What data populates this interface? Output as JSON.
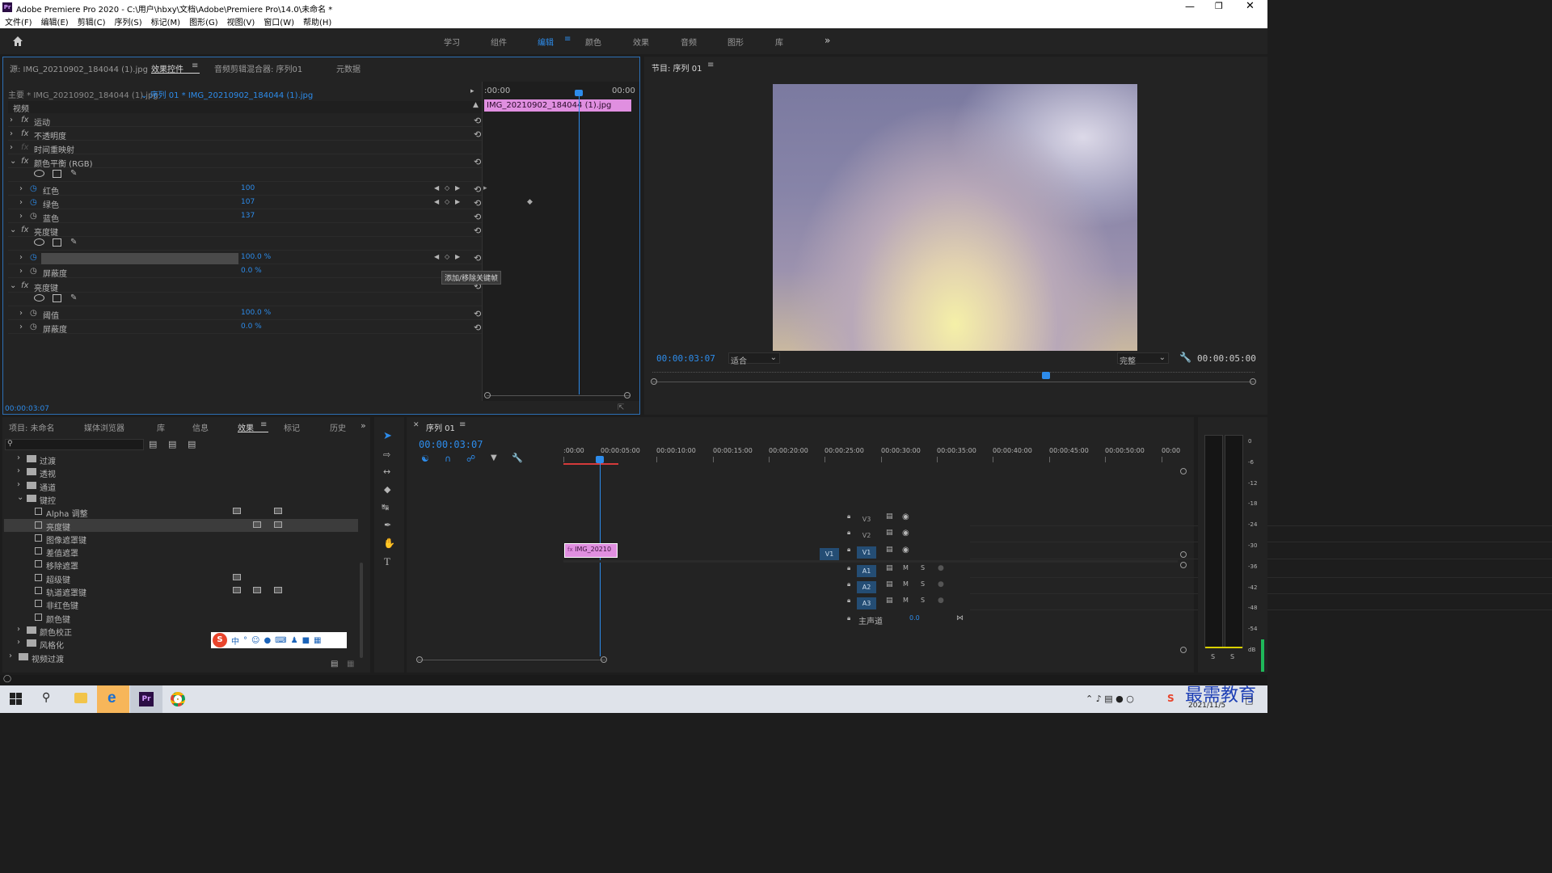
{
  "window": {
    "title": "Adobe Premiere Pro 2020 - C:\\用户\\hbxy\\文档\\Adobe\\Premiere Pro\\14.0\\未命名 *",
    "app_icon": "Pr"
  },
  "menu": [
    "文件(F)",
    "编辑(E)",
    "剪辑(C)",
    "序列(S)",
    "标记(M)",
    "图形(G)",
    "视图(V)",
    "窗口(W)",
    "帮助(H)"
  ],
  "workspaces": [
    {
      "label": "学习",
      "active": false
    },
    {
      "label": "组件",
      "active": false
    },
    {
      "label": "编辑",
      "active": true
    },
    {
      "label": "颜色",
      "active": false
    },
    {
      "label": "效果",
      "active": false
    },
    {
      "label": "音频",
      "active": false
    },
    {
      "label": "图形",
      "active": false
    },
    {
      "label": "库",
      "active": false
    }
  ],
  "effect_panel": {
    "tabs": [
      {
        "label": "源: IMG_20210902_184044 (1).jpg",
        "active": false
      },
      {
        "label": "效果控件",
        "active": true
      },
      {
        "label": "音频剪辑混合器: 序列01",
        "active": false
      },
      {
        "label": "元数据",
        "active": false
      }
    ],
    "master_label": "主要 * IMG_20210902_184044 (1).jpg",
    "sequence_label": "序列 01 * IMG_20210902_184044 (1).jpg",
    "section": "视频",
    "tl_start": ":00:00",
    "tl_end": "00:00",
    "clip_name": "IMG_20210902_184044 (1).jpg",
    "timecode": "00:00:03:07",
    "tooltip": "添加/移除关键帧",
    "rows": [
      {
        "type": "fx",
        "name": "运动"
      },
      {
        "type": "fx",
        "name": "不透明度"
      },
      {
        "type": "fx",
        "name": "时间重映射"
      },
      {
        "type": "fx",
        "name": "颜色平衡 (RGB)"
      },
      {
        "type": "prop",
        "name": "红色",
        "value": "100"
      },
      {
        "type": "prop",
        "name": "绿色",
        "value": "107"
      },
      {
        "type": "prop",
        "name": "蓝色",
        "value": "137"
      },
      {
        "type": "fx",
        "name": "亮度键"
      },
      {
        "type": "prop",
        "name": "阈值",
        "value": "100.0 %"
      },
      {
        "type": "prop",
        "name": "屏蔽度",
        "value": "0.0 %"
      },
      {
        "type": "fx",
        "name": "亮度键"
      },
      {
        "type": "prop",
        "name": "阈值",
        "value": "100.0 %"
      },
      {
        "type": "prop",
        "name": "屏蔽度",
        "value": "0.0 %"
      }
    ]
  },
  "program": {
    "title": "节目: 序列 01",
    "timecode": "00:00:03:07",
    "fit": "适合",
    "quality": "完整",
    "duration": "00:00:05:00"
  },
  "project": {
    "tabs": [
      {
        "label": "项目: 未命名",
        "active": false
      },
      {
        "label": "媒体浏览器",
        "active": false
      },
      {
        "label": "库",
        "active": false
      },
      {
        "label": "信息",
        "active": false
      },
      {
        "label": "效果",
        "active": true
      },
      {
        "label": "标记",
        "active": false
      },
      {
        "label": "历史",
        "active": false
      }
    ],
    "tree": [
      {
        "label": "过渡",
        "kind": "folder",
        "indent": 1
      },
      {
        "label": "透视",
        "kind": "folder",
        "indent": 1
      },
      {
        "label": "通道",
        "kind": "folder",
        "indent": 1
      },
      {
        "label": "键控",
        "kind": "folder-open",
        "indent": 1
      },
      {
        "label": "Alpha 调整",
        "kind": "effect",
        "indent": 2
      },
      {
        "label": "亮度键",
        "kind": "effect",
        "indent": 2,
        "selected": true
      },
      {
        "label": "图像遮罩键",
        "kind": "effect",
        "indent": 2
      },
      {
        "label": "差值遮罩",
        "kind": "effect",
        "indent": 2
      },
      {
        "label": "移除遮罩",
        "kind": "effect",
        "indent": 2
      },
      {
        "label": "超级键",
        "kind": "effect",
        "indent": 2
      },
      {
        "label": "轨道遮罩键",
        "kind": "effect",
        "indent": 2
      },
      {
        "label": "非红色键",
        "kind": "effect",
        "indent": 2
      },
      {
        "label": "颜色键",
        "kind": "effect",
        "indent": 2
      },
      {
        "label": "颜色校正",
        "kind": "folder",
        "indent": 1
      },
      {
        "label": "风格化",
        "kind": "folder",
        "indent": 1
      },
      {
        "label": "视频过渡",
        "kind": "folder",
        "indent": 0
      }
    ]
  },
  "timeline": {
    "title": "序列 01",
    "timecode": "00:00:03:07",
    "ruler": [
      ":00:00",
      "00:00:05:00",
      "00:00:10:00",
      "00:00:15:00",
      "00:00:20:00",
      "00:00:25:00",
      "00:00:30:00",
      "00:00:35:00",
      "00:00:40:00",
      "00:00:45:00",
      "00:00:50:00",
      "00:00"
    ],
    "video_tracks": [
      "V3",
      "V2",
      "V1"
    ],
    "audio_tracks": [
      "A1",
      "A2",
      "A3"
    ],
    "source_label": "V1",
    "master": {
      "label": "主声道",
      "value": "0.0"
    },
    "clip": "IMG_20210"
  },
  "meter": {
    "scale": [
      "0",
      "-6",
      "-12",
      "-18",
      "-24",
      "-30",
      "-36",
      "-42",
      "-48",
      "-54",
      "dB"
    ],
    "solo": [
      "S",
      "S"
    ]
  },
  "taskbar": {
    "date": "2021/11/5",
    "watermark": "最需教育"
  },
  "ime": {
    "label": "中"
  },
  "colors": {
    "accent": "#2d8ceb",
    "clip": "#e08fe0",
    "panel": "#232323",
    "bg": "#1d1d1d"
  }
}
